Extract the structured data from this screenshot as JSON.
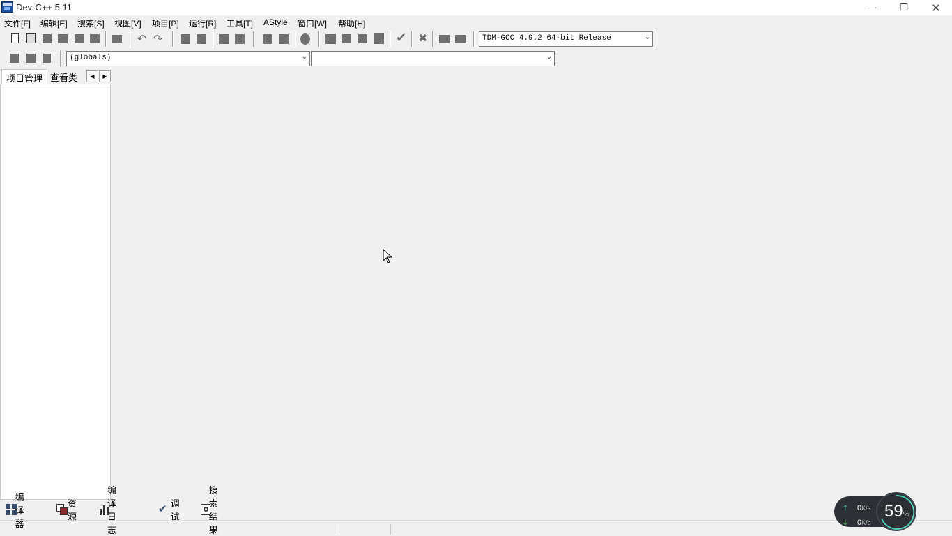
{
  "window": {
    "title": "Dev-C++ 5.11"
  },
  "menu": [
    "文件[F]",
    "编辑[E]",
    "搜索[S]",
    "视图[V]",
    "项目[P]",
    "运行[R]",
    "工具[T]",
    "AStyle",
    "窗口[W]",
    "帮助[H]"
  ],
  "compiler_select": {
    "value": "TDM-GCC 4.9.2 64-bit Release"
  },
  "class_select": {
    "value": "(globals)"
  },
  "member_select": {
    "value": ""
  },
  "left_tabs": [
    "项目管理",
    "查看类"
  ],
  "bottom_tabs": [
    "编译器",
    "资源",
    "编译日志",
    "调试",
    "搜索结果"
  ],
  "net": {
    "upload": "0",
    "download": "0",
    "unit": "K/s",
    "percent": "59",
    "percent_sign": "%"
  },
  "colors": {
    "accent_ring": "#4fd1b8",
    "app_icon": "#1e4f9e"
  }
}
